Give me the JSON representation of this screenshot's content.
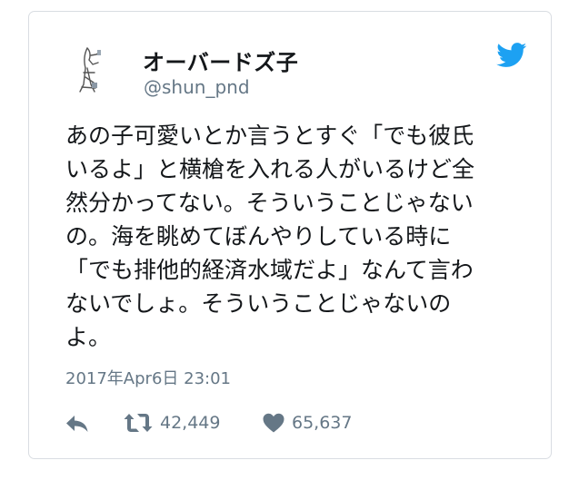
{
  "author": {
    "display_name": "オーバードズ子",
    "handle": "@shun_pnd"
  },
  "tweet": {
    "lines": [
      "あの子可愛いとか言うとすぐ「でも彼氏",
      "いるよ」と横槍を入れる人がいるけど全",
      "然分かってない。そういうことじゃない",
      "の。海を眺めてぼんやりしている時に",
      "「でも排他的経済水域だよ」なんて言わ",
      "ないでしょ。そういうことじゃないの",
      "よ。"
    ]
  },
  "timestamp": "2017年Apr6日 23:01",
  "actions": {
    "retweet_count": "42,449",
    "like_count": "65,637"
  },
  "icons": {
    "avatar": "avatar-illustration",
    "brand": "twitter-bird-icon",
    "reply": "reply-icon",
    "retweet": "retweet-icon",
    "like": "heart-icon"
  },
  "colors": {
    "brand": "#1da1f2",
    "text": "#14171a",
    "muted": "#657786",
    "border": "#d9dde2"
  }
}
